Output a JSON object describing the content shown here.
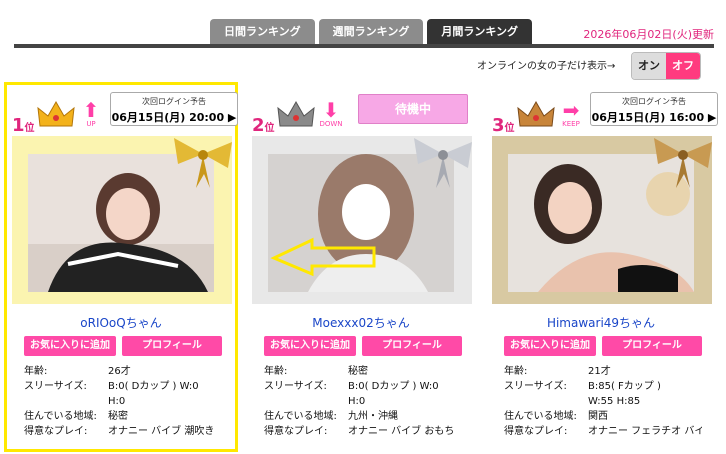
{
  "tabs": [
    {
      "label": "日間ランキング",
      "active": false
    },
    {
      "label": "週間ランキング",
      "active": false
    },
    {
      "label": "月間ランキング",
      "active": true
    }
  ],
  "updated": "2026年06月02日(火)更新",
  "online_filter": {
    "label": "オンラインの女の子だけ表示→",
    "on": "オン",
    "off": "オフ"
  },
  "cards": [
    {
      "rank": "1",
      "rank_suffix": "位",
      "trend": "UP",
      "notice_title": "次回ログイン予告",
      "notice_time": "06月15日(月) 20:00 ▶",
      "name": "oRIOoQちゃん",
      "fav": "お気に入りに追加",
      "profile": "プロフィール",
      "age_label": "年齢:",
      "age": "26才",
      "size_label": "スリーサイズ:",
      "size1": "B:0( Dカップ ) W:0",
      "size2": "H:0",
      "area_label": "住んでいる地域:",
      "area": "秘密",
      "play_label": "得意なプレイ:",
      "play": "オナニー バイブ 潮吹き"
    },
    {
      "rank": "2",
      "rank_suffix": "位",
      "trend": "DOWN",
      "waiting": "待機中",
      "name": "Moexxx02ちゃん",
      "fav": "お気に入りに追加",
      "profile": "プロフィール",
      "age_label": "年齢:",
      "age": "秘密",
      "size_label": "スリーサイズ:",
      "size1": "B:0( Dカップ ) W:0",
      "size2": "H:0",
      "area_label": "住んでいる地域:",
      "area": "九州・沖縄",
      "play_label": "得意なプレイ:",
      "play": "オナニー バイブ おもち"
    },
    {
      "rank": "3",
      "rank_suffix": "位",
      "trend": "KEEP",
      "notice_title": "次回ログイン予告",
      "notice_time": "06月15日(月) 16:00 ▶",
      "name": "Himawari49ちゃん",
      "fav": "お気に入りに追加",
      "profile": "プロフィール",
      "age_label": "年齢:",
      "age": "21才",
      "size_label": "スリーサイズ:",
      "size1": "B:85( Fカップ )",
      "size2": "W:55 H:85",
      "area_label": "住んでいる地域:",
      "area": "関西",
      "play_label": "得意なプレイ:",
      "play": "オナニー フェラチオ バイ"
    }
  ],
  "colors": {
    "accent": "#ff4aa7",
    "rank": "#e0267d",
    "frame1": "#fbf4b0",
    "frame2": "#e8e8e8",
    "frame3": "#d8c9a2"
  }
}
